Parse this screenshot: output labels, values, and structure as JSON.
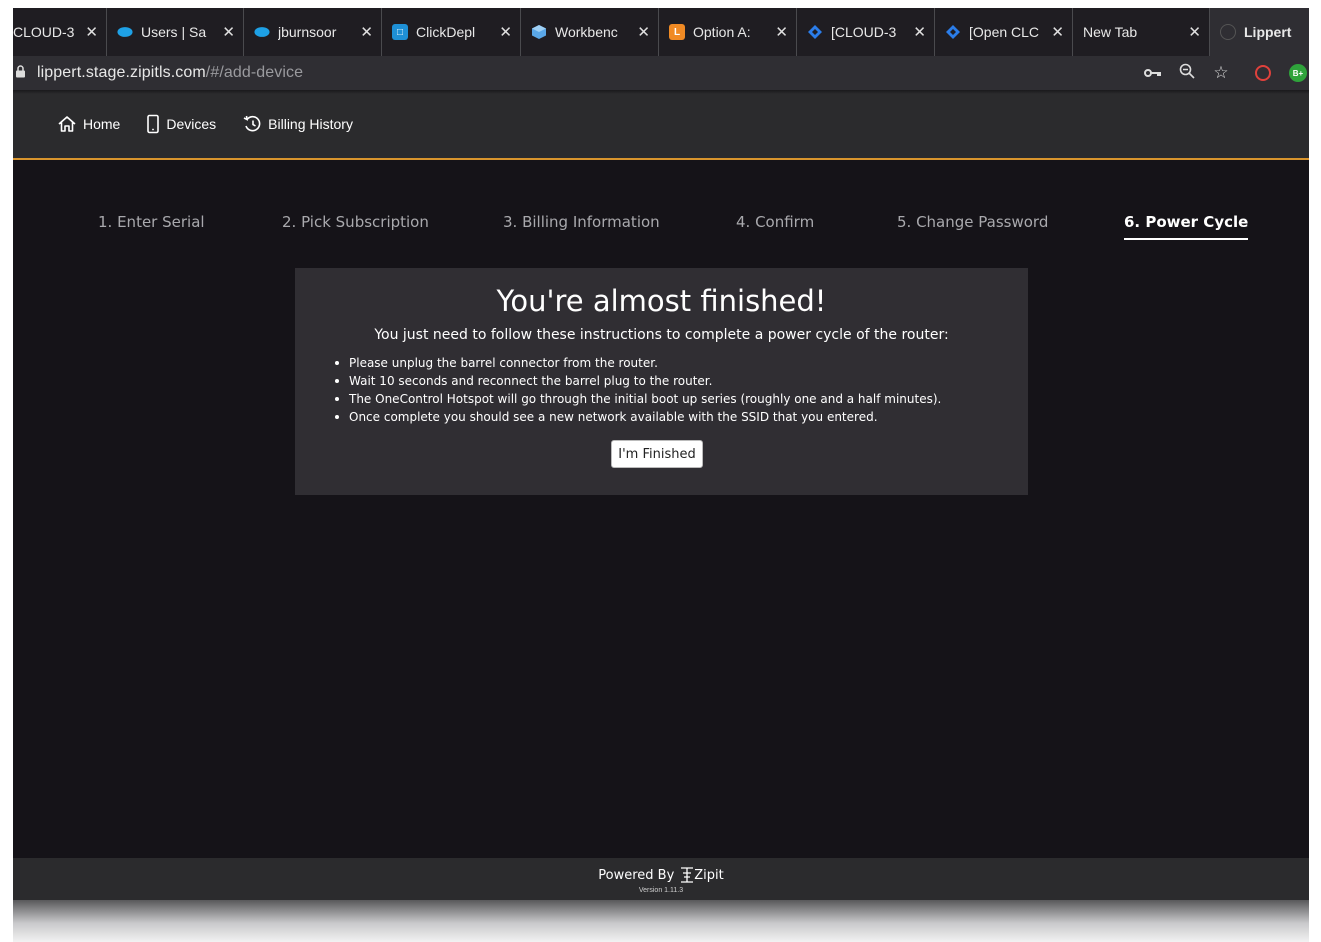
{
  "browser": {
    "tabs": [
      {
        "title": "CLOUD-3",
        "favicon": "jira-icon",
        "color": "",
        "closable": true
      },
      {
        "title": "Users | Sa",
        "favicon": "salesforce-cloud-icon",
        "color": "#1ea1e6",
        "closable": true
      },
      {
        "title": "jburnsoor",
        "favicon": "salesforce-cloud-icon",
        "color": "#1ea1e6",
        "closable": true
      },
      {
        "title": "ClickDepl",
        "favicon": "clickdeploy-icon",
        "color": "#1e90d6",
        "closable": true
      },
      {
        "title": "Workbenc",
        "favicon": "workbench-cube-icon",
        "color": "#5aa7e8",
        "closable": true
      },
      {
        "title": "Option A:",
        "favicon": "option-a-icon",
        "color": "#f08a24",
        "closable": true
      },
      {
        "title": "[CLOUD-3",
        "favicon": "jira-diamond-icon",
        "color": "#2b7de9",
        "closable": true
      },
      {
        "title": "[Open CLC",
        "favicon": "jira-diamond-icon",
        "color": "#2b7de9",
        "closable": true
      },
      {
        "title": "New Tab",
        "favicon": "",
        "color": "",
        "closable": true
      },
      {
        "title": "Lippert",
        "favicon": "globe-icon",
        "color": "#666",
        "closable": false,
        "active": true
      }
    ],
    "url": {
      "host": "lippert.stage.zipitls.com",
      "path": "/#/add-device"
    },
    "extension_badge": "B+"
  },
  "nav": {
    "home": "Home",
    "devices": "Devices",
    "billing": "Billing History"
  },
  "steps": [
    "1. Enter Serial",
    "2. Pick Subscription",
    "3. Billing Information",
    "4. Confirm",
    "5. Change Password",
    "6. Power Cycle"
  ],
  "card": {
    "title": "You're almost finished!",
    "subtitle": "You just need to follow these instructions to complete a power cycle of the router:",
    "instructions": [
      "Please unplug the barrel connector from the router.",
      "Wait 10 seconds and reconnect the barrel plug to the router.",
      "The OneControl Hotspot will go through the initial boot up series (roughly one and a half minutes).",
      "Once complete you should see a new network available with the SSID that you entered."
    ],
    "button": "I'm Finished"
  },
  "footer": {
    "powered_by": "Powered By",
    "brand": "Zipit",
    "version": "Version 1.11.3"
  },
  "colors": {
    "accent": "#d9952d",
    "background": "#151318",
    "card": "#302e33"
  }
}
